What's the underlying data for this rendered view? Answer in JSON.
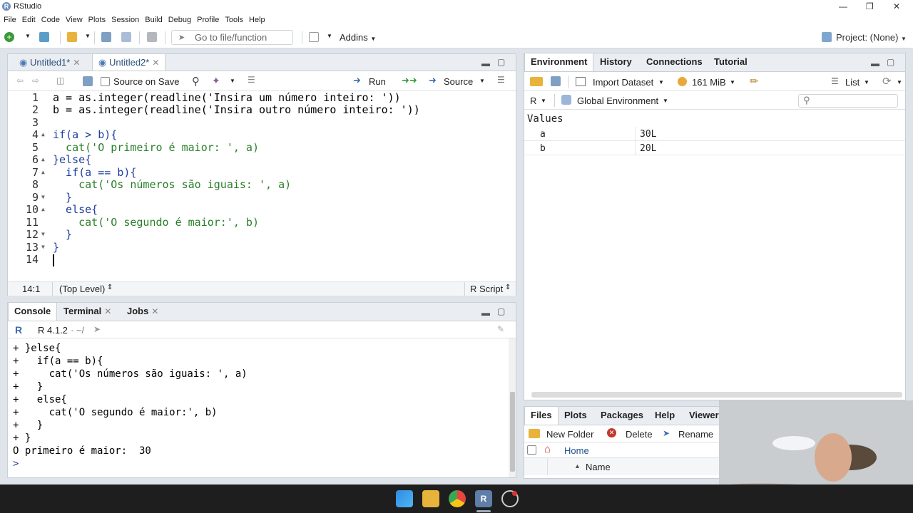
{
  "window": {
    "title": "RStudio"
  },
  "menu": [
    "File",
    "Edit",
    "Code",
    "View",
    "Plots",
    "Session",
    "Build",
    "Debug",
    "Profile",
    "Tools",
    "Help"
  ],
  "toolbar": {
    "goto_placeholder": "Go to file/function",
    "addins_label": "Addins",
    "project_label": "Project: (None)"
  },
  "editor": {
    "tabs": [
      {
        "label": "Untitled1*"
      },
      {
        "label": "Untitled2*"
      }
    ],
    "source_on_save": "Source on Save",
    "run_label": "Run",
    "source_label": "Source",
    "lines": [
      {
        "n": "1",
        "code": "a = as.integer(readline('Insira um número inteiro: '))"
      },
      {
        "n": "2",
        "code": "b = as.integer(readline('Insira outro número inteiro: '))"
      },
      {
        "n": "3",
        "code": ""
      },
      {
        "n": "4",
        "code": "if(a > b){"
      },
      {
        "n": "5",
        "code": "  cat('O primeiro é maior: ', a)"
      },
      {
        "n": "6",
        "code": "}else{"
      },
      {
        "n": "7",
        "code": "  if(a == b){"
      },
      {
        "n": "8",
        "code": "    cat('Os números são iguais: ', a)"
      },
      {
        "n": "9",
        "code": "  }"
      },
      {
        "n": "10",
        "code": "  else{"
      },
      {
        "n": "11",
        "code": "    cat('O segundo é maior:', b)"
      },
      {
        "n": "12",
        "code": "  }"
      },
      {
        "n": "13",
        "code": "}"
      },
      {
        "n": "14",
        "code": ""
      }
    ],
    "status_position": "14:1",
    "status_scope": "(Top Level)",
    "status_type": "R Script"
  },
  "console": {
    "tabs": [
      {
        "label": "Console"
      },
      {
        "label": "Terminal"
      },
      {
        "label": "Jobs"
      }
    ],
    "r_version": "R 4.1.2",
    "path": "· ~/",
    "lines": [
      "+ }else{",
      "+   if(a == b){",
      "+     cat('Os números são iguais: ', a)",
      "+   }",
      "+   else{",
      "+     cat('O segundo é maior:', b)",
      "+   }",
      "+ }",
      "O primeiro é maior:  30",
      "> "
    ]
  },
  "environment": {
    "tabs": [
      {
        "label": "Environment"
      },
      {
        "label": "History"
      },
      {
        "label": "Connections"
      },
      {
        "label": "Tutorial"
      }
    ],
    "import_label": "Import Dataset",
    "memory_label": "161 MiB",
    "view_label": "List",
    "lang_label": "R",
    "scope_label": "Global Environment",
    "values_header": "Values",
    "values": [
      {
        "name": "a",
        "value": "30L"
      },
      {
        "name": "b",
        "value": "20L"
      }
    ]
  },
  "files": {
    "tabs": [
      {
        "label": "Files"
      },
      {
        "label": "Plots"
      },
      {
        "label": "Packages"
      },
      {
        "label": "Help"
      },
      {
        "label": "Viewer"
      }
    ],
    "new_folder": "New Folder",
    "delete": "Delete",
    "rename": "Rename",
    "home": "Home",
    "name_col": "Name"
  },
  "colors": {
    "accent": "#4a7ab5",
    "keyword": "#1f3f9f",
    "string": "#2a7f2a"
  }
}
